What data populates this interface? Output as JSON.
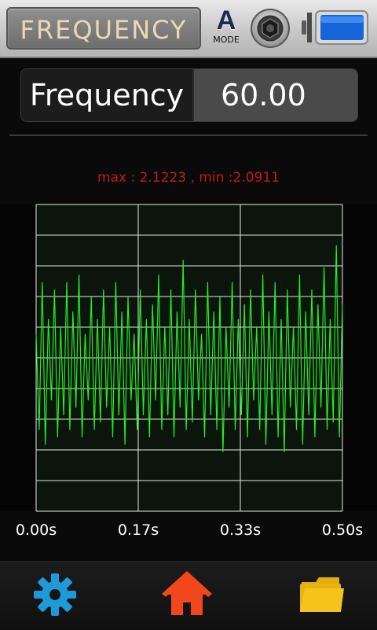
{
  "header": {
    "title": "FREQUENCY",
    "mode_letter": "A",
    "mode_label": "MODE",
    "camera_icon": "camera-shutter-icon",
    "battery_icon": "battery-icon",
    "battery_level": 1.0
  },
  "measurement": {
    "label": "Frequency",
    "value": "60.00"
  },
  "stats": {
    "text": "max : 2.1223 , min :2.0911"
  },
  "chart_data": {
    "type": "line",
    "x_ticks": [
      "0.00s",
      "0.17s",
      "0.33s",
      "0.50s"
    ],
    "xlim": [
      0,
      0.5
    ],
    "grid": true,
    "series": [
      {
        "color": "#22ee22",
        "x": [
          0.0,
          0.005,
          0.01,
          0.015,
          0.02,
          0.025,
          0.03,
          0.035,
          0.04,
          0.045,
          0.05,
          0.055,
          0.06,
          0.065,
          0.07,
          0.075,
          0.08,
          0.085,
          0.09,
          0.095,
          0.1,
          0.105,
          0.11,
          0.115,
          0.12,
          0.125,
          0.13,
          0.135,
          0.14,
          0.145,
          0.15,
          0.155,
          0.16,
          0.165,
          0.17,
          0.175,
          0.18,
          0.185,
          0.19,
          0.195,
          0.2,
          0.205,
          0.21,
          0.215,
          0.22,
          0.225,
          0.23,
          0.235,
          0.24,
          0.245,
          0.25,
          0.255,
          0.26,
          0.265,
          0.27,
          0.275,
          0.28,
          0.285,
          0.29,
          0.295,
          0.3,
          0.305,
          0.31,
          0.315,
          0.32,
          0.325,
          0.33,
          0.335,
          0.34,
          0.345,
          0.35,
          0.355,
          0.36,
          0.365,
          0.37,
          0.375,
          0.38,
          0.385,
          0.39,
          0.395,
          0.4,
          0.405,
          0.41,
          0.415,
          0.42,
          0.425,
          0.43,
          0.435,
          0.44,
          0.445,
          0.45,
          0.455,
          0.46,
          0.465,
          0.47,
          0.475,
          0.48,
          0.485,
          0.49,
          0.495,
          0.5
        ],
        "y": [
          2.11,
          2.097,
          2.117,
          2.095,
          2.112,
          2.101,
          2.116,
          2.096,
          2.111,
          2.099,
          2.117,
          2.097,
          2.113,
          2.1,
          2.118,
          2.096,
          2.11,
          2.101,
          2.115,
          2.097,
          2.112,
          2.098,
          2.116,
          2.1,
          2.111,
          2.096,
          2.117,
          2.099,
          2.113,
          2.095,
          2.115,
          2.101,
          2.11,
          2.097,
          2.116,
          2.099,
          2.112,
          2.096,
          2.114,
          2.101,
          2.118,
          2.097,
          2.111,
          2.099,
          2.116,
          2.096,
          2.113,
          2.1,
          2.12,
          2.097,
          2.112,
          2.098,
          2.116,
          2.101,
          2.11,
          2.096,
          2.117,
          2.099,
          2.113,
          2.097,
          2.115,
          2.094,
          2.111,
          2.1,
          2.117,
          2.097,
          2.112,
          2.099,
          2.114,
          2.096,
          2.116,
          2.101,
          2.111,
          2.097,
          2.118,
          2.095,
          2.113,
          2.099,
          2.117,
          2.096,
          2.112,
          2.094,
          2.116,
          2.1,
          2.111,
          2.097,
          2.118,
          2.095,
          2.113,
          2.099,
          2.116,
          2.096,
          2.114,
          2.1,
          2.119,
          2.097,
          2.112,
          2.098,
          2.122,
          2.096,
          2.114
        ]
      }
    ],
    "ylim": [
      2.086,
      2.1275
    ]
  },
  "bottom_nav": [
    {
      "icon": "gear-icon",
      "color": "#1e9ad8"
    },
    {
      "icon": "home-icon",
      "color": "#f2471c"
    },
    {
      "icon": "folder-icon",
      "color": "#f3c219"
    }
  ]
}
